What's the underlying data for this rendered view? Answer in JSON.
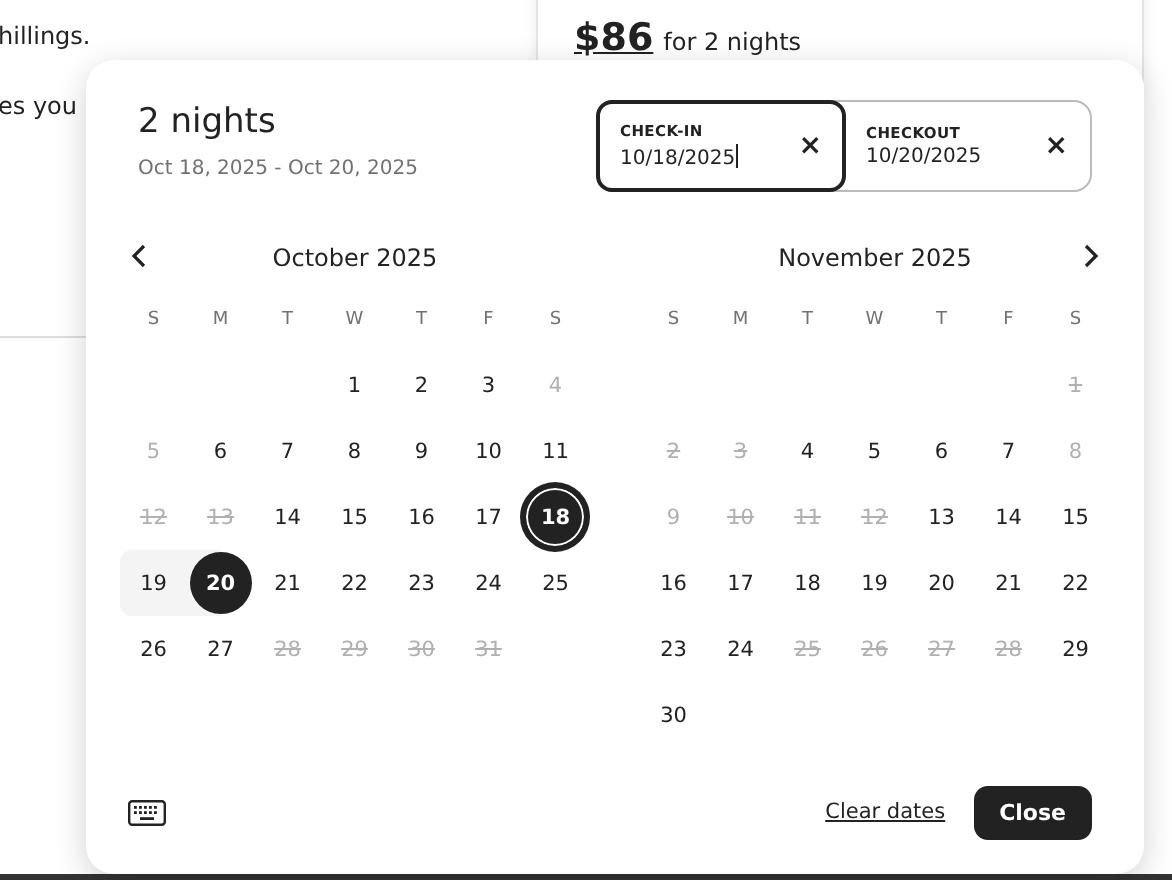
{
  "background": {
    "lines": [
      "hillings.",
      "es you"
    ],
    "price": "$86",
    "price_suffix": "for 2 nights"
  },
  "picker": {
    "title": "2 nights",
    "subtitle": "Oct 18, 2025 - Oct 20, 2025",
    "fields": [
      {
        "label": "CHECK-IN",
        "value": "10/18/2025",
        "focused": true,
        "clear": "×"
      },
      {
        "label": "CHECKOUT",
        "value": "10/20/2025",
        "focused": false,
        "clear": "×"
      }
    ],
    "months": [
      {
        "title": "October 2025",
        "prev_arrow": true,
        "weekdays": [
          "S",
          "M",
          "T",
          "W",
          "T",
          "F",
          "S"
        ],
        "weeks": [
          {
            "right_aligned": true,
            "days": [
              {
                "d": "1",
                "kind": "open"
              },
              {
                "d": "2",
                "kind": "open"
              },
              {
                "d": "3",
                "kind": "open"
              },
              {
                "d": "4",
                "kind": "unavailable"
              }
            ]
          },
          {
            "days": [
              {
                "d": "5",
                "kind": "unavailable"
              },
              {
                "d": "6",
                "kind": "open"
              },
              {
                "d": "7",
                "kind": "open"
              },
              {
                "d": "8",
                "kind": "open"
              },
              {
                "d": "9",
                "kind": "open"
              },
              {
                "d": "10",
                "kind": "open"
              },
              {
                "d": "11",
                "kind": "open"
              }
            ]
          },
          {
            "days": [
              {
                "d": "12",
                "kind": "blocked"
              },
              {
                "d": "13",
                "kind": "blocked"
              },
              {
                "d": "14",
                "kind": "open"
              },
              {
                "d": "15",
                "kind": "open"
              },
              {
                "d": "16",
                "kind": "open"
              },
              {
                "d": "17",
                "kind": "open"
              },
              {
                "d": "18",
                "kind": "start"
              }
            ]
          },
          {
            "days": [
              {
                "d": "19",
                "kind": "range"
              },
              {
                "d": "20",
                "kind": "end"
              },
              {
                "d": "21",
                "kind": "open"
              },
              {
                "d": "22",
                "kind": "open"
              },
              {
                "d": "23",
                "kind": "open"
              },
              {
                "d": "24",
                "kind": "open"
              },
              {
                "d": "25",
                "kind": "open"
              }
            ]
          },
          {
            "days": [
              {
                "d": "26",
                "kind": "open"
              },
              {
                "d": "27",
                "kind": "open"
              },
              {
                "d": "28",
                "kind": "blocked"
              },
              {
                "d": "29",
                "kind": "blocked"
              },
              {
                "d": "30",
                "kind": "blocked"
              },
              {
                "d": "31",
                "kind": "blocked"
              }
            ]
          }
        ]
      },
      {
        "title": "November 2025",
        "next_arrow": true,
        "weekdays": [
          "S",
          "M",
          "T",
          "W",
          "T",
          "F",
          "S"
        ],
        "weeks": [
          {
            "right_aligned": true,
            "days": [
              {
                "d": "1",
                "kind": "blocked"
              }
            ]
          },
          {
            "days": [
              {
                "d": "2",
                "kind": "blocked"
              },
              {
                "d": "3",
                "kind": "blocked"
              },
              {
                "d": "4",
                "kind": "open"
              },
              {
                "d": "5",
                "kind": "open"
              },
              {
                "d": "6",
                "kind": "open"
              },
              {
                "d": "7",
                "kind": "open"
              },
              {
                "d": "8",
                "kind": "unavailable"
              }
            ]
          },
          {
            "days": [
              {
                "d": "9",
                "kind": "unavailable"
              },
              {
                "d": "10",
                "kind": "blocked"
              },
              {
                "d": "11",
                "kind": "blocked"
              },
              {
                "d": "12",
                "kind": "blocked"
              },
              {
                "d": "13",
                "kind": "open"
              },
              {
                "d": "14",
                "kind": "open"
              },
              {
                "d": "15",
                "kind": "open"
              }
            ]
          },
          {
            "days": [
              {
                "d": "16",
                "kind": "open"
              },
              {
                "d": "17",
                "kind": "open"
              },
              {
                "d": "18",
                "kind": "open"
              },
              {
                "d": "19",
                "kind": "open"
              },
              {
                "d": "20",
                "kind": "open"
              },
              {
                "d": "21",
                "kind": "open"
              },
              {
                "d": "22",
                "kind": "open"
              }
            ]
          },
          {
            "days": [
              {
                "d": "23",
                "kind": "open"
              },
              {
                "d": "24",
                "kind": "open"
              },
              {
                "d": "25",
                "kind": "blocked"
              },
              {
                "d": "26",
                "kind": "blocked"
              },
              {
                "d": "27",
                "kind": "blocked"
              },
              {
                "d": "28",
                "kind": "blocked"
              },
              {
                "d": "29",
                "kind": "open"
              }
            ]
          },
          {
            "days": [
              {
                "d": "30",
                "kind": "open"
              }
            ]
          }
        ]
      }
    ],
    "clear_link": "Clear dates",
    "close_button": "Close"
  }
}
